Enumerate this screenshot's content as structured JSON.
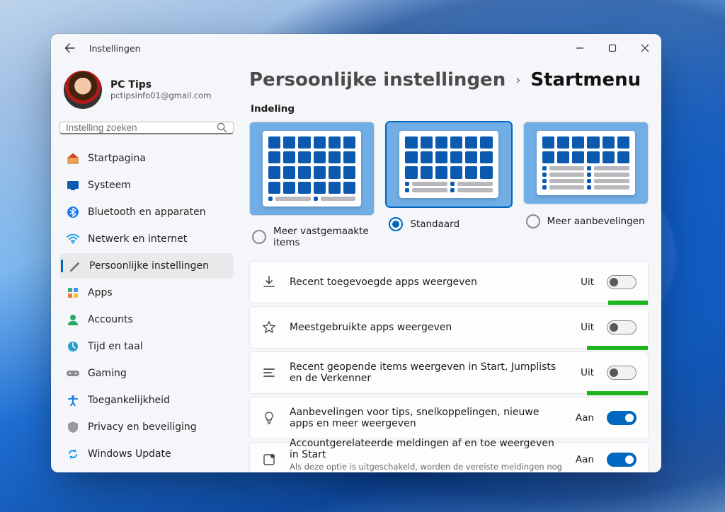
{
  "app_title": "Instellingen",
  "profile": {
    "name": "PC Tips",
    "email": "pctipsinfo01@gmail.com"
  },
  "search": {
    "placeholder": "Instelling zoeken"
  },
  "nav": [
    {
      "label": "Startpagina"
    },
    {
      "label": "Systeem"
    },
    {
      "label": "Bluetooth en apparaten"
    },
    {
      "label": "Netwerk en internet"
    },
    {
      "label": "Persoonlijke instellingen"
    },
    {
      "label": "Apps"
    },
    {
      "label": "Accounts"
    },
    {
      "label": "Tijd en taal"
    },
    {
      "label": "Gaming"
    },
    {
      "label": "Toegankelijkheid"
    },
    {
      "label": "Privacy en beveiliging"
    },
    {
      "label": "Windows Update"
    }
  ],
  "breadcrumb": {
    "parent": "Persoonlijke instellingen",
    "current": "Startmenu"
  },
  "section_label": "Indeling",
  "layouts": {
    "opt1": "Meer vastgemaakte items",
    "opt2": "Standaard",
    "opt3": "Meer aanbevelingen"
  },
  "settings": [
    {
      "title": "Recent toegevoegde apps weergeven",
      "state": "Uit",
      "on": false,
      "highlight_w": 56
    },
    {
      "title": "Meestgebruikte apps weergeven",
      "state": "Uit",
      "on": false,
      "highlight_w": 86
    },
    {
      "title": "Recent geopende items weergeven in Start, Jumplists en de Verkenner",
      "state": "Uit",
      "on": false,
      "highlight_w": 86
    },
    {
      "title": "Aanbevelingen voor tips, snelkoppelingen, nieuwe apps en meer weergeven",
      "state": "Aan",
      "on": true
    },
    {
      "title": "Accountgerelateerde meldingen af en toe weergeven in Start",
      "desc": "Als deze optie is uitgeschakeld, worden de vereiste meldingen nog steeds",
      "state": "Aan",
      "on": true
    }
  ]
}
